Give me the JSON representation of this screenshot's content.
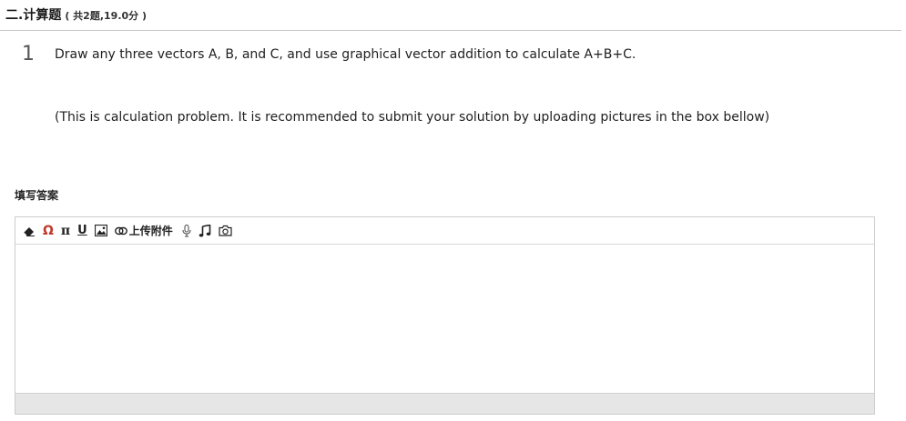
{
  "section": {
    "title": "二.计算题",
    "meta": "( 共2题,19.0分 )"
  },
  "question": {
    "number": "1",
    "text": "Draw any three vectors A, B, and C, and use graphical vector addition to calculate A+B+C.",
    "note": "(This is calculation problem. It is recommended to submit your solution by uploading pictures in the box bellow)"
  },
  "answer": {
    "label": "填写答案"
  },
  "editor": {
    "toolbar": {
      "omega_label": "Ω",
      "pi_label": "π",
      "underline_label": "U",
      "attach_label": "上传附件"
    },
    "icons": [
      "eraser-icon",
      "omega-icon",
      "pi-icon",
      "underline-icon",
      "image-icon",
      "link-icon",
      "microphone-icon",
      "music-icon",
      "camera-icon"
    ],
    "colors": {
      "omega": "#c0392b",
      "status_bar": "#e6e6e6"
    }
  }
}
